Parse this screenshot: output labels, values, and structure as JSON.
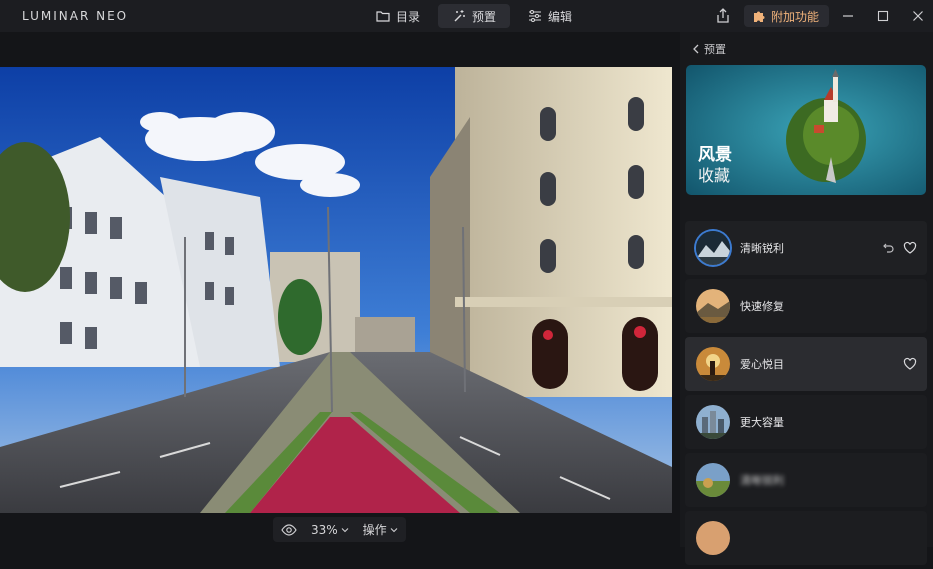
{
  "app": {
    "logo": "LUMINAR NEO"
  },
  "tabs": [
    {
      "label": "目录",
      "icon": "folder-icon"
    },
    {
      "label": "预置",
      "icon": "magic-wand-icon",
      "active": true
    },
    {
      "label": "编辑",
      "icon": "sliders-icon"
    }
  ],
  "toolbar": {
    "addons_label": "附加功能"
  },
  "colors": {
    "accent": "#3c7bd1",
    "addon": "#f0b27a",
    "panel_bg": "#18191c"
  },
  "bottombar": {
    "zoom": "33%",
    "actions_label": "操作"
  },
  "panel": {
    "back_label": "预置",
    "hero": {
      "title": "风景",
      "subtitle": "收藏"
    },
    "presets": [
      {
        "label": "清晰锐利",
        "selected": true
      },
      {
        "label": "快速修复"
      },
      {
        "label": "爱心悦目",
        "hover": true
      },
      {
        "label": "更大容量"
      },
      {
        "label": "清晰锐利"
      },
      {
        "label": ""
      }
    ]
  }
}
